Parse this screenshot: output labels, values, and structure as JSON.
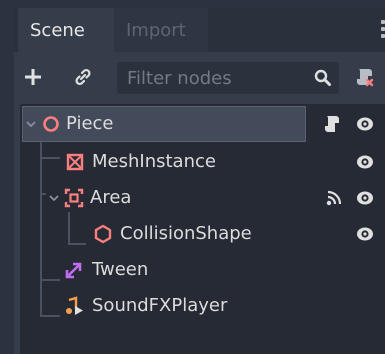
{
  "tabs": {
    "scene": "Scene",
    "import": "Import"
  },
  "toolbar": {
    "filter_placeholder": "Filter nodes"
  },
  "tree": {
    "nodes": [
      {
        "label": "Piece",
        "icon": "spatial-icon",
        "selected": true,
        "has_script": true,
        "visible": true
      },
      {
        "label": "MeshInstance",
        "icon": "mesh-instance-icon",
        "visible": true
      },
      {
        "label": "Area",
        "icon": "area-icon",
        "has_signals": true,
        "visible": true
      },
      {
        "label": "CollisionShape",
        "icon": "collision-shape-icon",
        "visible": true
      },
      {
        "label": "Tween",
        "icon": "tween-icon"
      },
      {
        "label": "SoundFXPlayer",
        "icon": "audio-player-icon"
      }
    ]
  },
  "colors": {
    "accent_red": "#fc7f7f",
    "accent_purple": "#c06cf3",
    "accent_orange": "#f7a04a",
    "panel_bg": "#363d4a",
    "tree_bg": "#252a34"
  }
}
